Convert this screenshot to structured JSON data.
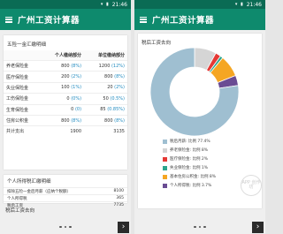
{
  "status_time": "21:46",
  "status_icons": "▾ ▮",
  "app_title": "广州工资计算器",
  "left": {
    "section1_title": "五险一金汇缴明细",
    "table": {
      "headers": [
        "",
        "个人缴纳部分",
        "单位缴纳部分"
      ],
      "rows": [
        {
          "name": "养老保险金",
          "personal": "800",
          "personal_pct": "(8%)",
          "company": "1200",
          "company_pct": "(12%)"
        },
        {
          "name": "医疗保险金",
          "personal": "200",
          "personal_pct": "(2%)",
          "company": "800",
          "company_pct": "(8%)"
        },
        {
          "name": "失业保险金",
          "personal": "100",
          "personal_pct": "(1%)",
          "company": "20",
          "company_pct": "(2%)"
        },
        {
          "name": "工伤保险金",
          "personal": "0",
          "personal_pct": "(0%)",
          "company": "50",
          "company_pct": "(0.5%)"
        },
        {
          "name": "生育保险金",
          "personal": "0",
          "personal_pct": "(0)",
          "company": "85",
          "company_pct": "(0.85%)"
        },
        {
          "name": "住房公积金",
          "personal": "800",
          "personal_pct": "(8%)",
          "company": "800",
          "company_pct": "(8%)"
        },
        {
          "name": "共计支出",
          "personal": "1900",
          "personal_pct": "",
          "company": "3135",
          "company_pct": ""
        }
      ]
    },
    "section2_title": "个人所得税汇缴明细",
    "tax": [
      {
        "label": "扣除五险一金后月薪（应纳个税额）",
        "value": "8100"
      },
      {
        "label": "个人所得税",
        "value": "365"
      },
      {
        "label": "税后工资",
        "value": "7735"
      }
    ],
    "section3_title": "税后工资去向"
  },
  "right": {
    "section_title": "税后工资去向",
    "legend": [
      {
        "label": "税后月薪: 比例 77.4%",
        "color": "#9fbfd1"
      },
      {
        "label": "养老保险金: 比例 8%",
        "color": "#d5d5d5"
      },
      {
        "label": "医疗保险金: 比例 2%",
        "color": "#e53935"
      },
      {
        "label": "失业保险金: 比例 1%",
        "color": "#2ca58d"
      },
      {
        "label": "基本住房公积金: 比例 8%",
        "color": "#f5a623"
      },
      {
        "label": "个人所得税: 比例 3.7%",
        "color": "#6a4c93"
      }
    ],
    "watermark": "APP 创作坊"
  },
  "chart_data": {
    "type": "pie",
    "donut": true,
    "labels": [
      "税后月薪",
      "养老保险金",
      "医疗保险金",
      "失业保险金",
      "基本住房公积金",
      "个人所得税"
    ],
    "values": [
      77.4,
      8,
      2,
      1,
      8,
      3.7
    ],
    "colors": [
      "#9fbfd1",
      "#d5d5d5",
      "#e53935",
      "#2ca58d",
      "#f5a623",
      "#6a4c93"
    ],
    "title": "税后工资去向"
  }
}
